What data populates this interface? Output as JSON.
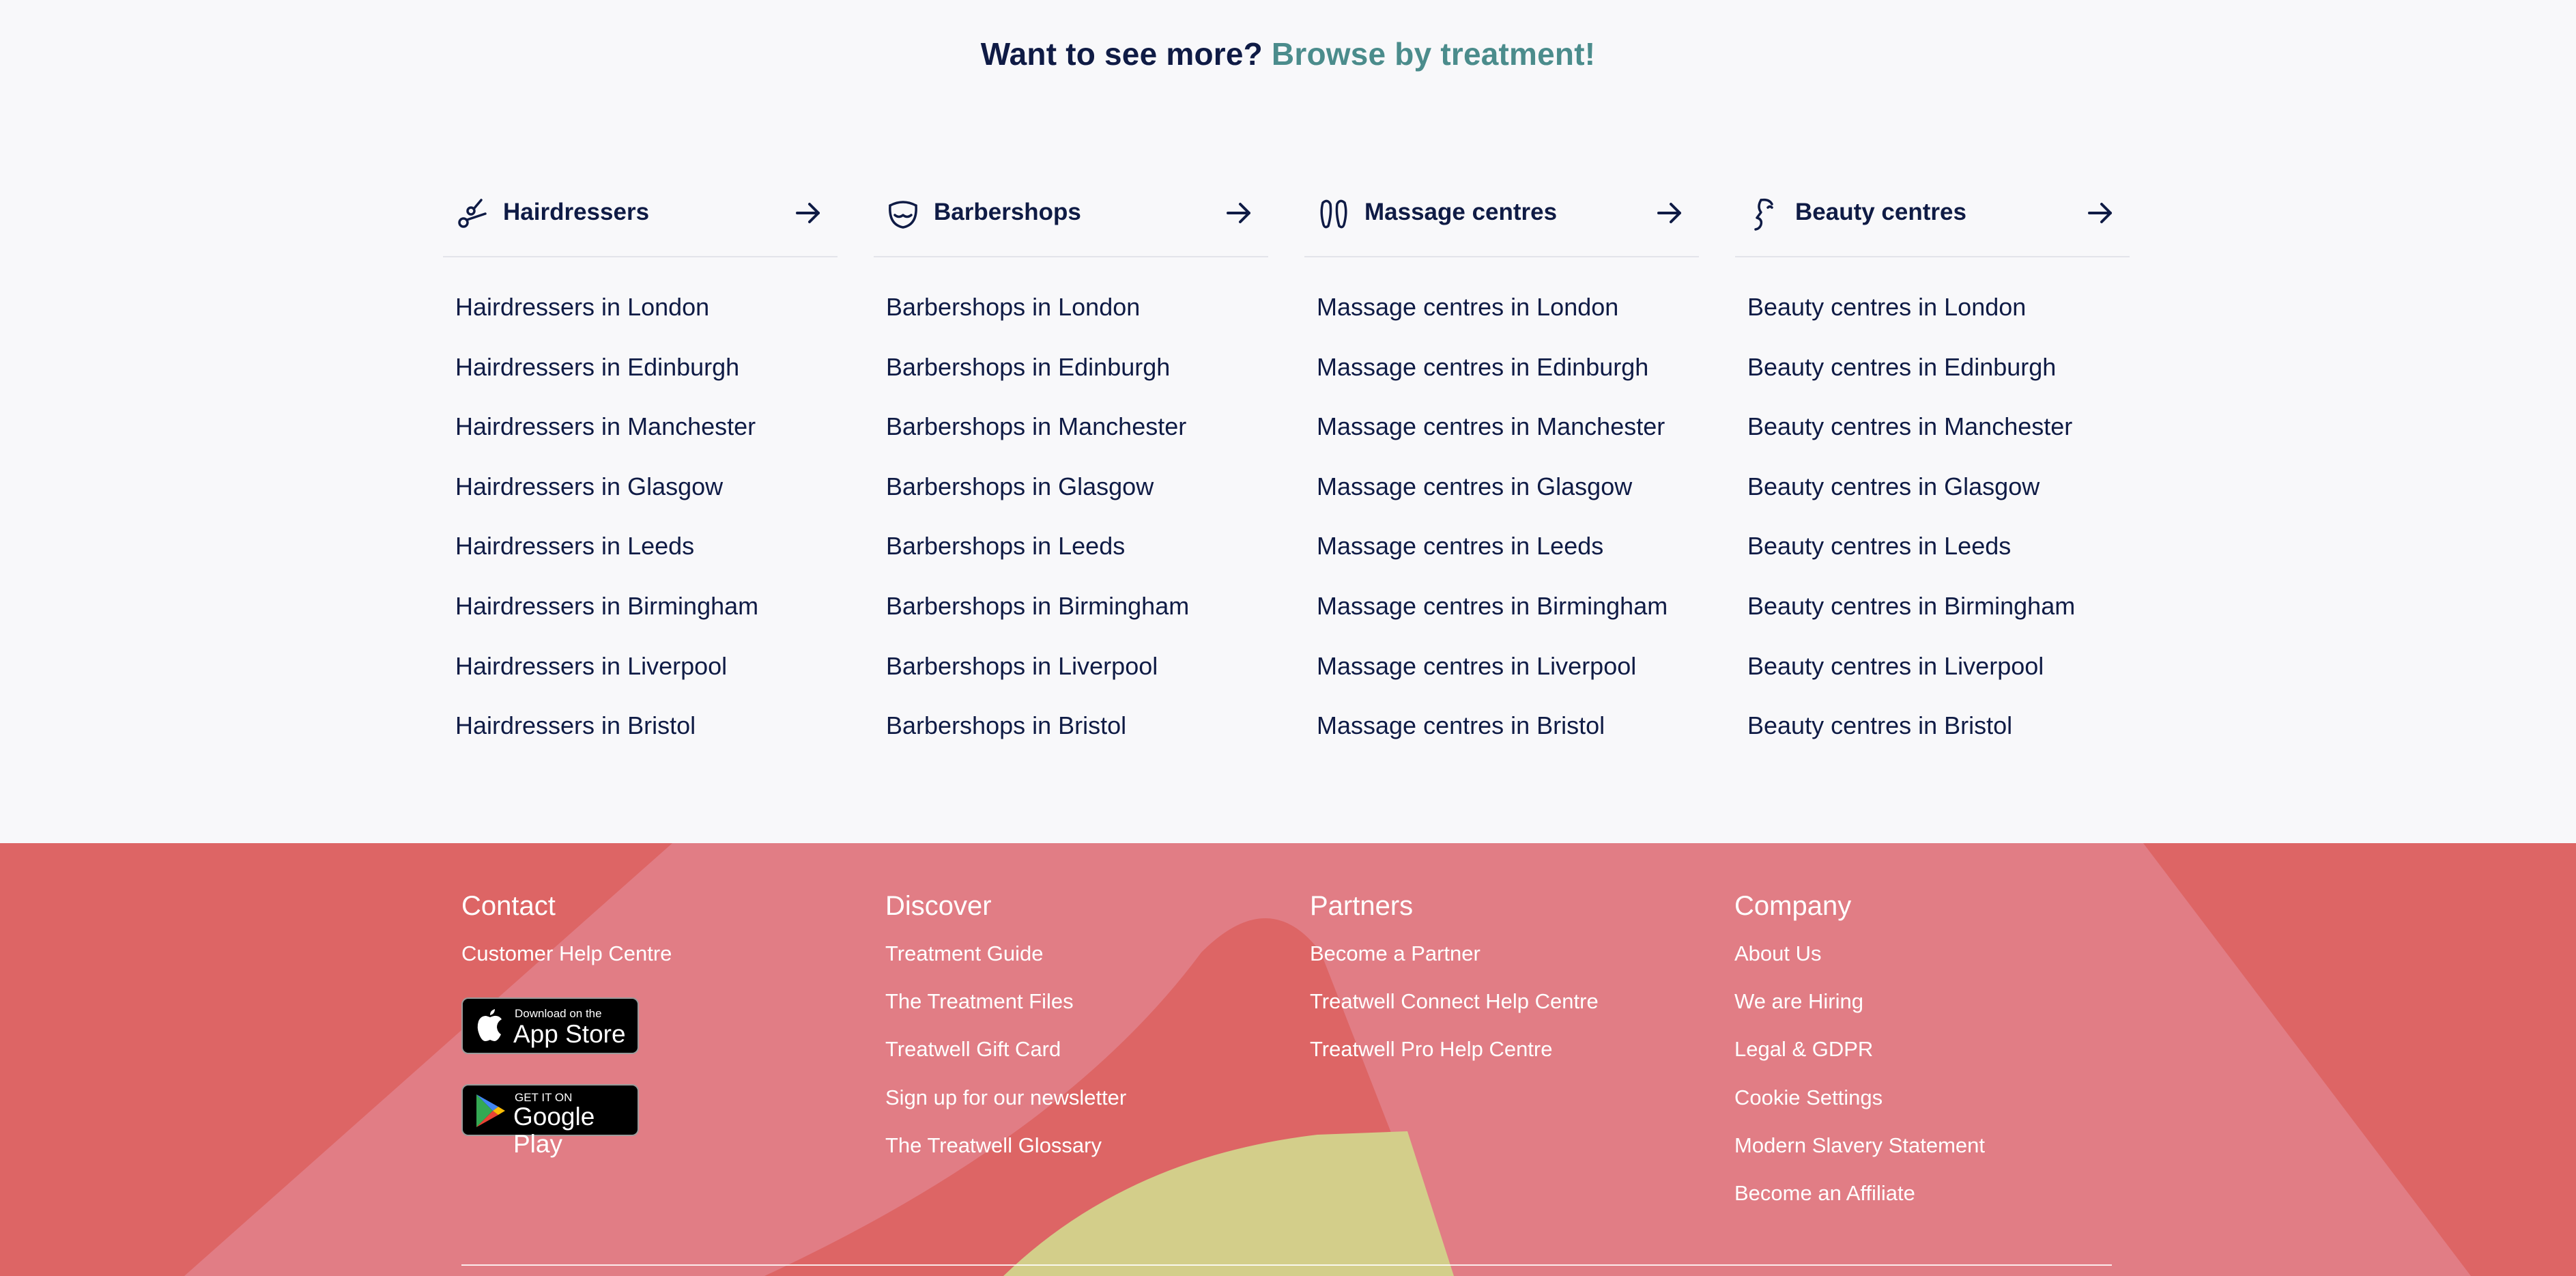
{
  "headline": {
    "lead": "Want to see more?",
    "link": "Browse by treatment!"
  },
  "columns": [
    {
      "icon": "scissors-icon",
      "title": "Hairdressers",
      "links": [
        "Hairdressers in London",
        "Hairdressers in Edinburgh",
        "Hairdressers in Manchester",
        "Hairdressers in Glasgow",
        "Hairdressers in Leeds",
        "Hairdressers in Birmingham",
        "Hairdressers in Liverpool",
        "Hairdressers in Bristol"
      ]
    },
    {
      "icon": "moustache-face-icon",
      "title": "Barbershops",
      "links": [
        "Barbershops in London",
        "Barbershops in Edinburgh",
        "Barbershops in Manchester",
        "Barbershops in Glasgow",
        "Barbershops in Leeds",
        "Barbershops in Birmingham",
        "Barbershops in Liverpool",
        "Barbershops in Bristol"
      ]
    },
    {
      "icon": "footprints-icon",
      "title": "Massage centres",
      "links": [
        "Massage centres in London",
        "Massage centres in Edinburgh",
        "Massage centres in Manchester",
        "Massage centres in Glasgow",
        "Massage centres in Leeds",
        "Massage centres in Birmingham",
        "Massage centres in Liverpool",
        "Massage centres in Bristol"
      ]
    },
    {
      "icon": "face-profile-icon",
      "title": "Beauty centres",
      "links": [
        "Beauty centres in London",
        "Beauty centres in Edinburgh",
        "Beauty centres in Manchester",
        "Beauty centres in Glasgow",
        "Beauty centres in Leeds",
        "Beauty centres in Birmingham",
        "Beauty centres in Liverpool",
        "Beauty centres in Bristol"
      ]
    }
  ],
  "footer": {
    "contact": {
      "title": "Contact",
      "links": [
        "Customer Help Centre"
      ],
      "app_store": {
        "small": "Download on the",
        "big": "App Store"
      },
      "google_play": {
        "small": "GET IT ON",
        "big": "Google Play"
      }
    },
    "discover": {
      "title": "Discover",
      "links": [
        "Treatment Guide",
        "The Treatment Files",
        "Treatwell Gift Card",
        "Sign up for our newsletter",
        "The Treatwell Glossary"
      ]
    },
    "partners": {
      "title": "Partners",
      "links": [
        "Become a Partner",
        "Treatwell Connect Help Centre",
        "Treatwell Pro Help Centre"
      ]
    },
    "company": {
      "title": "Company",
      "links": [
        "About Us",
        "We are Hiring",
        "Legal & GDPR",
        "Cookie Settings",
        "Modern Slavery Statement",
        "Become an Affiliate"
      ]
    }
  },
  "colors": {
    "text": "#0f1b45",
    "accent": "#4b8c8c",
    "footer_red": "#dd6565",
    "footer_pink": "#e17d85",
    "footer_yellow": "#d3ce8a"
  }
}
